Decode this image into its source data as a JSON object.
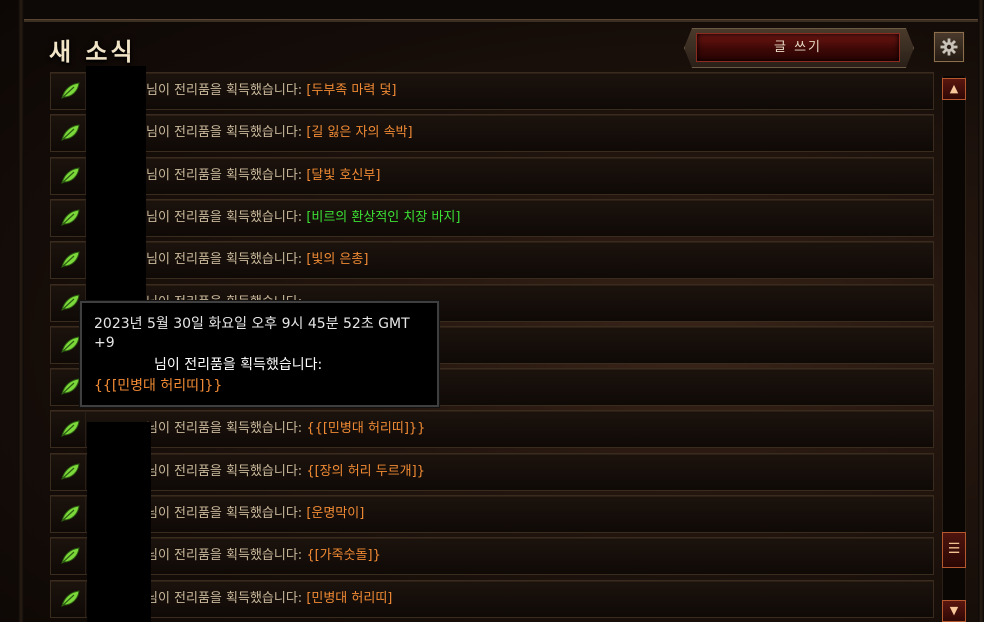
{
  "header": {
    "title": "새 소식",
    "write_button": "글 쓰기",
    "settings_icon": "gear-icon"
  },
  "colors": {
    "legendary_item": "#f08a34",
    "set_item": "#3be034",
    "body_text": "#c9b89b",
    "accent_red": "#6e1612"
  },
  "feed": {
    "message": "님이 전리품을 획득했습니다: ",
    "items": [
      {
        "item": "[두부족 마력 덫]",
        "rarity": "legendary"
      },
      {
        "item": "[길 잃은 자의 속박]",
        "rarity": "legendary"
      },
      {
        "item": "[달빛 호신부]",
        "rarity": "legendary"
      },
      {
        "item": "[비르의 환상적인 치장 바지]",
        "rarity": "set"
      },
      {
        "item": "[빛의 은총]",
        "rarity": "legendary"
      },
      {
        "item": "",
        "rarity": "legendary"
      },
      {
        "item": "",
        "rarity": "legendary"
      },
      {
        "item": "",
        "rarity": "legendary"
      },
      {
        "item": "{{[민병대 허리띠]}}",
        "rarity": "legendary"
      },
      {
        "item": "{[장의 허리 두르개]}",
        "rarity": "legendary"
      },
      {
        "item": "[운명막이]",
        "rarity": "legendary"
      },
      {
        "item": "{[가죽숫돌]}",
        "rarity": "legendary"
      },
      {
        "item": "[민병대 허리띠]",
        "rarity": "legendary"
      }
    ]
  },
  "tooltip": {
    "timestamp": "2023년 5월 30일 화요일 오후 9시 45분 52초 GMT +9",
    "message": "님이 전리품을 획득했습니다:",
    "item": "{{[민병대 허리띠]}}"
  },
  "scrollbar": {
    "up_label": "▲",
    "down_label": "▼",
    "thumb_label": "☰"
  }
}
